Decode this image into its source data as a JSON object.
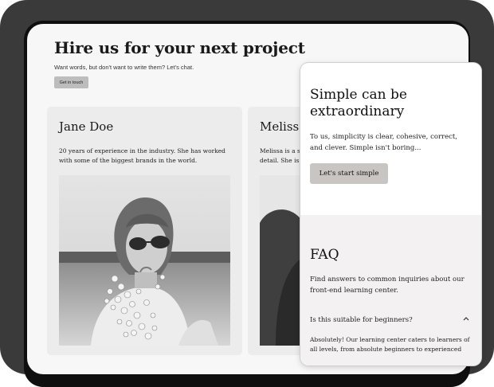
{
  "hero": {
    "title": "Hire us for your next project",
    "subtitle": "Want words, but don't want to write them? Let's chat.",
    "button_label": "Get in touch"
  },
  "team": [
    {
      "name": "Jane Doe",
      "bio": "20 years of experience in the industry. She has worked with some of the biggest brands in the world."
    },
    {
      "name": "Melissa",
      "bio_line1": "Melissa is a s",
      "bio_line2": "detail. She is a"
    }
  ],
  "promo": {
    "title": "Simple can be extraordinary",
    "text": "To us, simplicity is clear, cohesive, correct, and clever. Simple isn't boring...",
    "button_label": "Let's start simple"
  },
  "faq": {
    "title": "FAQ",
    "subtitle": "Find answers to common inquiries about our front-end learning center.",
    "items": [
      {
        "question": "Is this suitable for beginners?",
        "answer": "Absolutely! Our learning center caters to learners of all levels, from absolute beginners to experienced"
      }
    ],
    "chevron_icon": "chevron-up-icon"
  },
  "colors": {
    "device": "#3a3a3a",
    "page_bg": "#f7f7f7",
    "card_bg": "#ececec",
    "faq_bg": "#f3f1f1",
    "button_bg": "#c9c5c3"
  }
}
